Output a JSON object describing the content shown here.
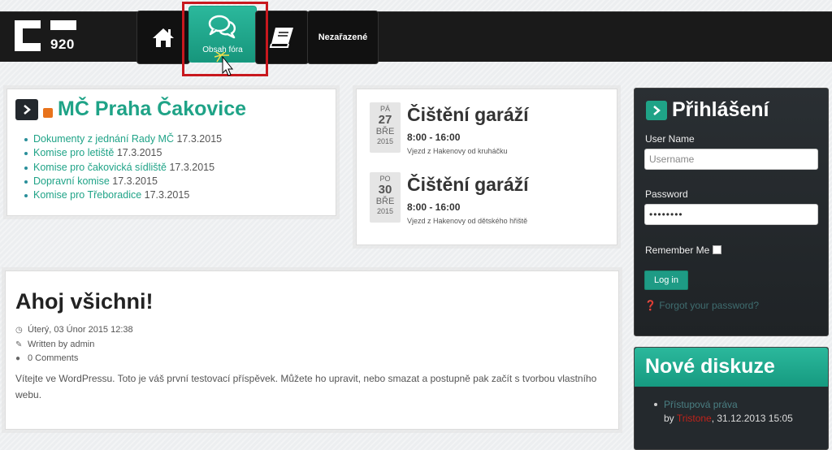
{
  "header": {
    "logo_number": "920",
    "nav": {
      "forum_label": "Obsah fóra",
      "uncategorized_label": "Nezařazené"
    }
  },
  "news": {
    "title": "MČ Praha Čakovice",
    "items": [
      {
        "link": "Dokumenty z jednání Rady MČ",
        "date": "17.3.2015"
      },
      {
        "link": "Komise pro letiště",
        "date": "17.3.2015"
      },
      {
        "link": "Komise pro čakovická sídliště",
        "date": "17.3.2015"
      },
      {
        "link": "Dopravní komise",
        "date": "17.3.2015"
      },
      {
        "link": "Komise pro Třeboradice",
        "date": "17.3.2015"
      }
    ]
  },
  "events": [
    {
      "day": "PÁ",
      "num": "27",
      "month": "BŘE",
      "year": "2015",
      "title": "Čištění garáží",
      "time": "8:00 - 16:00",
      "location": "Vjezd z Hakenovy od kruháčku"
    },
    {
      "day": "PO",
      "num": "30",
      "month": "BŘE",
      "year": "2015",
      "title": "Čištění garáží",
      "time": "8:00 - 16:00",
      "location": "Vjezd z Hakenovy od dětského hřiště"
    }
  ],
  "post": {
    "title": "Ahoj všichni!",
    "date": "Úterý, 03 Únor 2015 12:38",
    "author": "Written by admin",
    "comments": "0 Comments",
    "body": "Vítejte ve WordPressu. Toto je váš první testovací příspěvek. Můžete ho upravit, nebo smazat a postupně pak začít s tvorbou vlastního webu."
  },
  "login": {
    "title": "Přihlášení",
    "username_label": "User Name",
    "username_placeholder": "Username",
    "password_label": "Password",
    "password_value": "••••••••",
    "remember_label": "Remember Me",
    "login_button": "Log in",
    "forgot": "Forgot your password?"
  },
  "discussions": {
    "title": "Nové diskuze",
    "item_topic": "Přístupová práva",
    "item_by": "by",
    "item_user": "Tristone",
    "item_date": ", 31.12.2013 15:05"
  },
  "colors": {
    "accent": "#1fa387",
    "header_bg": "#1a1a1a",
    "highlight": "#c8181e"
  }
}
